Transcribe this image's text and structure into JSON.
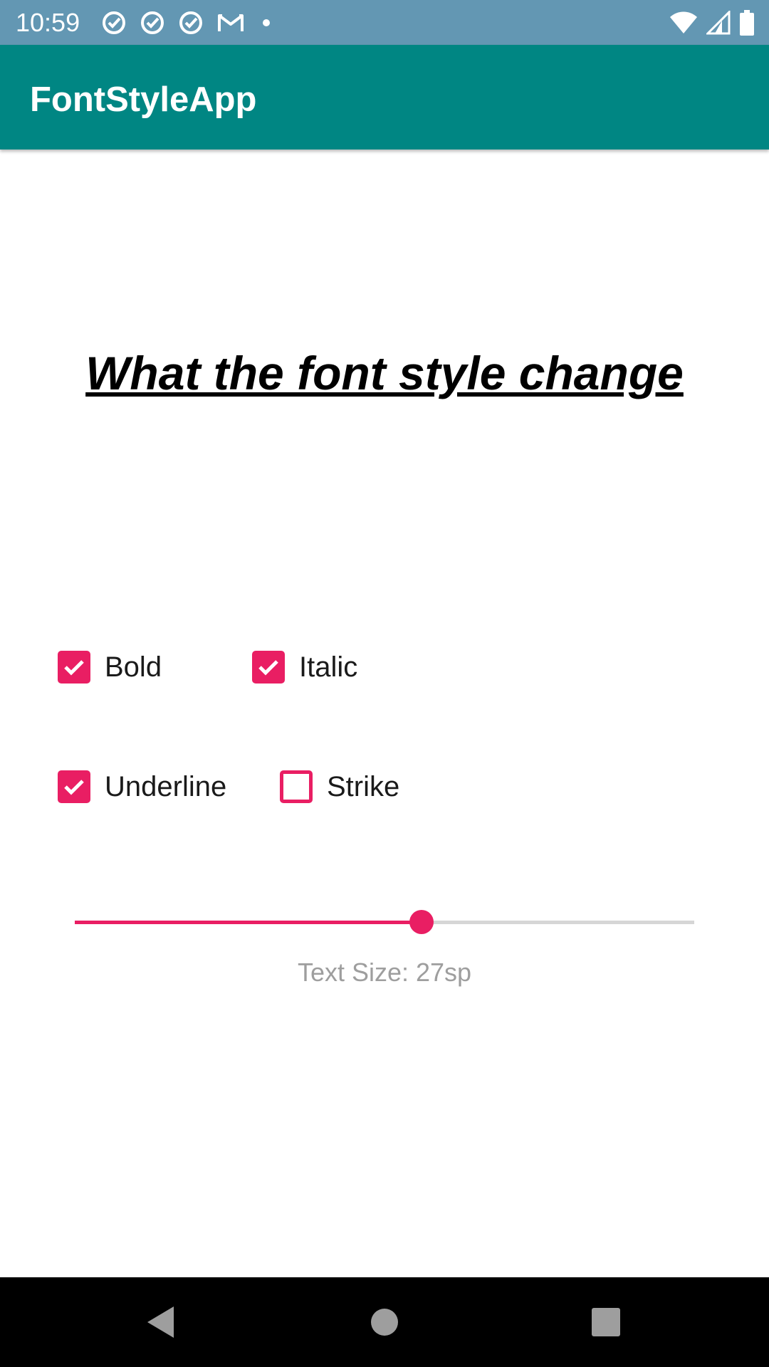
{
  "status_bar": {
    "time": "10:59",
    "left_icons": [
      "check-circle-icon",
      "check-circle-icon",
      "check-circle-icon",
      "gmail-icon",
      "dot-icon"
    ],
    "right_icons": [
      "wifi-icon",
      "signal-icon",
      "battery-icon"
    ]
  },
  "app_bar": {
    "title": "FontStyleApp",
    "color": "#008683"
  },
  "preview": {
    "text": "What the font style change"
  },
  "options": {
    "bold": {
      "label": "Bold",
      "checked": true
    },
    "italic": {
      "label": "Italic",
      "checked": true
    },
    "underline": {
      "label": "Underline",
      "checked": true
    },
    "strike": {
      "label": "Strike",
      "checked": false
    }
  },
  "slider": {
    "fraction": 0.56,
    "accent": "#e91e63"
  },
  "size_label": "Text Size: 27sp",
  "nav_bar": {
    "buttons": [
      "back-icon",
      "home-icon",
      "recents-icon"
    ]
  }
}
